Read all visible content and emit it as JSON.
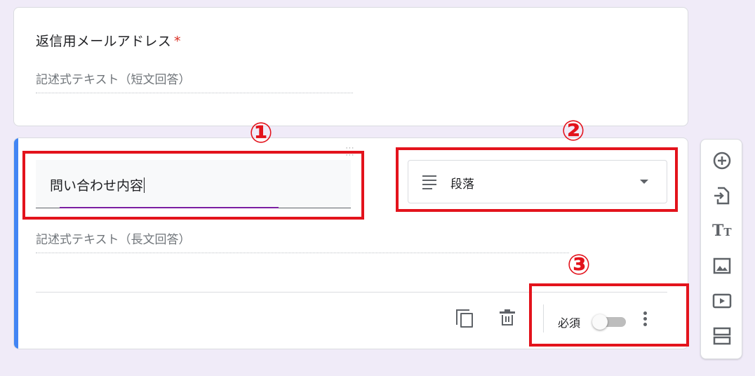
{
  "email_question": {
    "title": "返信用メールアドレス",
    "required_mark": "*",
    "answer_hint": "記述式テキスト（短文回答）"
  },
  "inquiry_question": {
    "title_value": "問い合わせ内容",
    "type_label": "段落",
    "answer_hint": "記述式テキスト（長文回答）",
    "required_label": "必須",
    "required_on": false
  },
  "annotations": [
    "①",
    "②",
    "③"
  ],
  "colors": {
    "background": "#f0ebf8",
    "accent": "#4285f4",
    "focus_underline": "#7b1fa2",
    "annotation_red": "#e3131c",
    "required_red": "#d93025"
  },
  "icons": {
    "question_type": "paragraph-lines-icon",
    "duplicate": "copy-icon",
    "delete": "trash-icon",
    "more": "more-vert-icon",
    "toolbar": [
      "add-circle-icon",
      "import-questions-icon",
      "title-text-icon",
      "image-icon",
      "video-icon",
      "section-icon"
    ]
  }
}
